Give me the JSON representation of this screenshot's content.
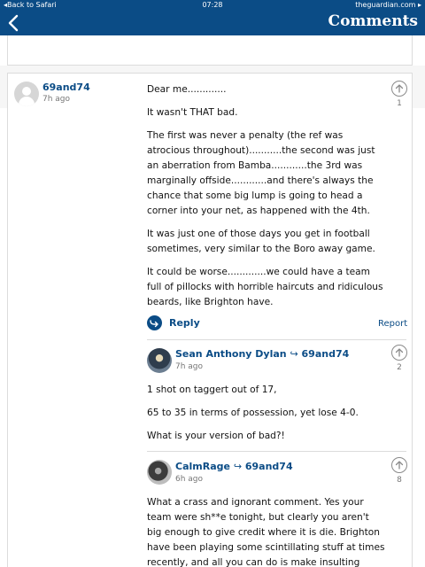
{
  "statusbar": {
    "back_label": "Back to Safari",
    "time": "07:28",
    "site": "theguardian.com"
  },
  "navbar": {
    "title": "Comments"
  },
  "comments": [
    {
      "author": "69and74",
      "time": "7h ago",
      "recommend_count": "1",
      "paragraphs": [
        "Dear me.............",
        "It wasn't THAT bad.",
        "The first was never a penalty (the ref was atrocious throughout)...........the second was just an aberration from Bamba............the 3rd was marginally offside............and there's always the chance that some big lump is going to head a corner into your net, as happened with the 4th.",
        "It was just one of those days you get in football sometimes, very similar to the Boro away game.",
        "It could be worse.............we could have a team full of pillocks with horrible haircuts and ridiculous beards, like Brighton have."
      ],
      "reply_label": "Reply",
      "report_label": "Report"
    },
    {
      "author": "Sean Anthony Dylan",
      "reply_to": "69and74",
      "time": "7h ago",
      "recommend_count": "2",
      "paragraphs": [
        "1 shot on taggert out of 17,",
        "65 to 35 in terms of possession, yet lose 4-0.",
        "What is your version of bad?!"
      ]
    },
    {
      "author": "CalmRage",
      "reply_to": "69and74",
      "time": "6h ago",
      "recommend_count": "8",
      "paragraphs": [
        "What a crass and ignorant comment. Yes your team were sh**e tonight, but clearly you aren't big enough to give credit where it is die. Brighton have been playing some scintillating stuff at times recently, and all you can do is make insulting school boy comments."
      ]
    }
  ]
}
